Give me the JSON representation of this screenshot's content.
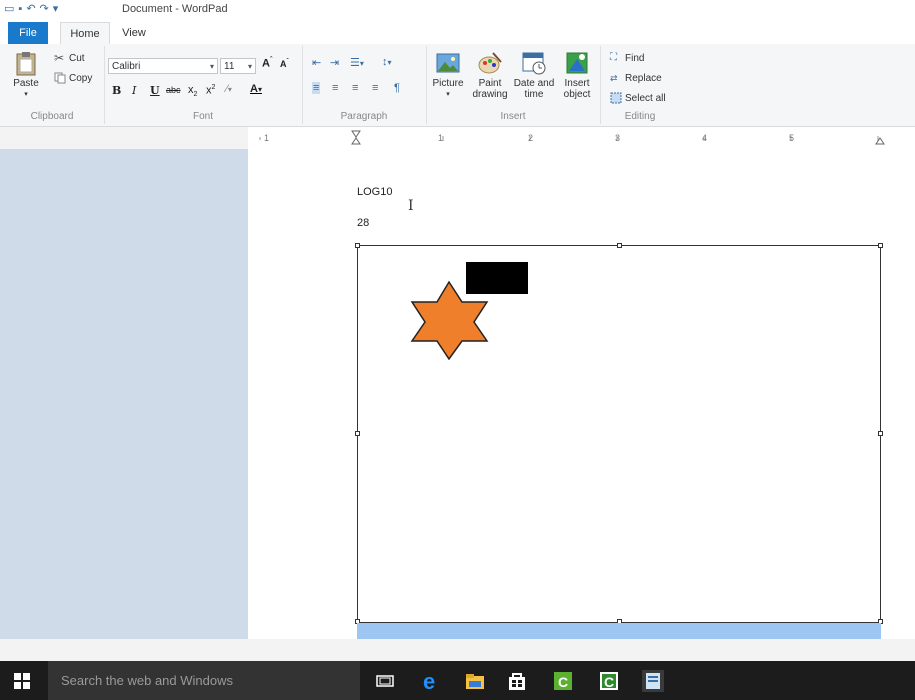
{
  "window": {
    "title": "Document - WordPad"
  },
  "tabs": [
    {
      "label": "File"
    },
    {
      "label": "Home"
    },
    {
      "label": "View"
    }
  ],
  "ribbon": {
    "clipboard": {
      "label": "Clipboard",
      "paste": "Paste",
      "cut": "Cut",
      "copy": "Copy"
    },
    "font": {
      "label": "Font",
      "family": "Calibri",
      "size": "11"
    },
    "paragraph": {
      "label": "Paragraph"
    },
    "insert": {
      "label": "Insert",
      "picture": "Picture",
      "paint_drawing": [
        "Paint",
        "drawing"
      ],
      "date_time": [
        "Date and",
        "time"
      ],
      "insert_object": [
        "Insert",
        "object"
      ]
    },
    "editing": {
      "label": "Editing",
      "find": "Find",
      "replace": "Replace",
      "select_all": "Select all"
    }
  },
  "document": {
    "line1": "LOG10",
    "line2": "28"
  },
  "taskbar": {
    "search_placeholder": "Search the web and Windows"
  },
  "colors": {
    "file_tab": "#1979ca",
    "star_fill": "#f07f2c",
    "workarea": "#cfdbe9",
    "taskbar": "#1c1c1c"
  }
}
